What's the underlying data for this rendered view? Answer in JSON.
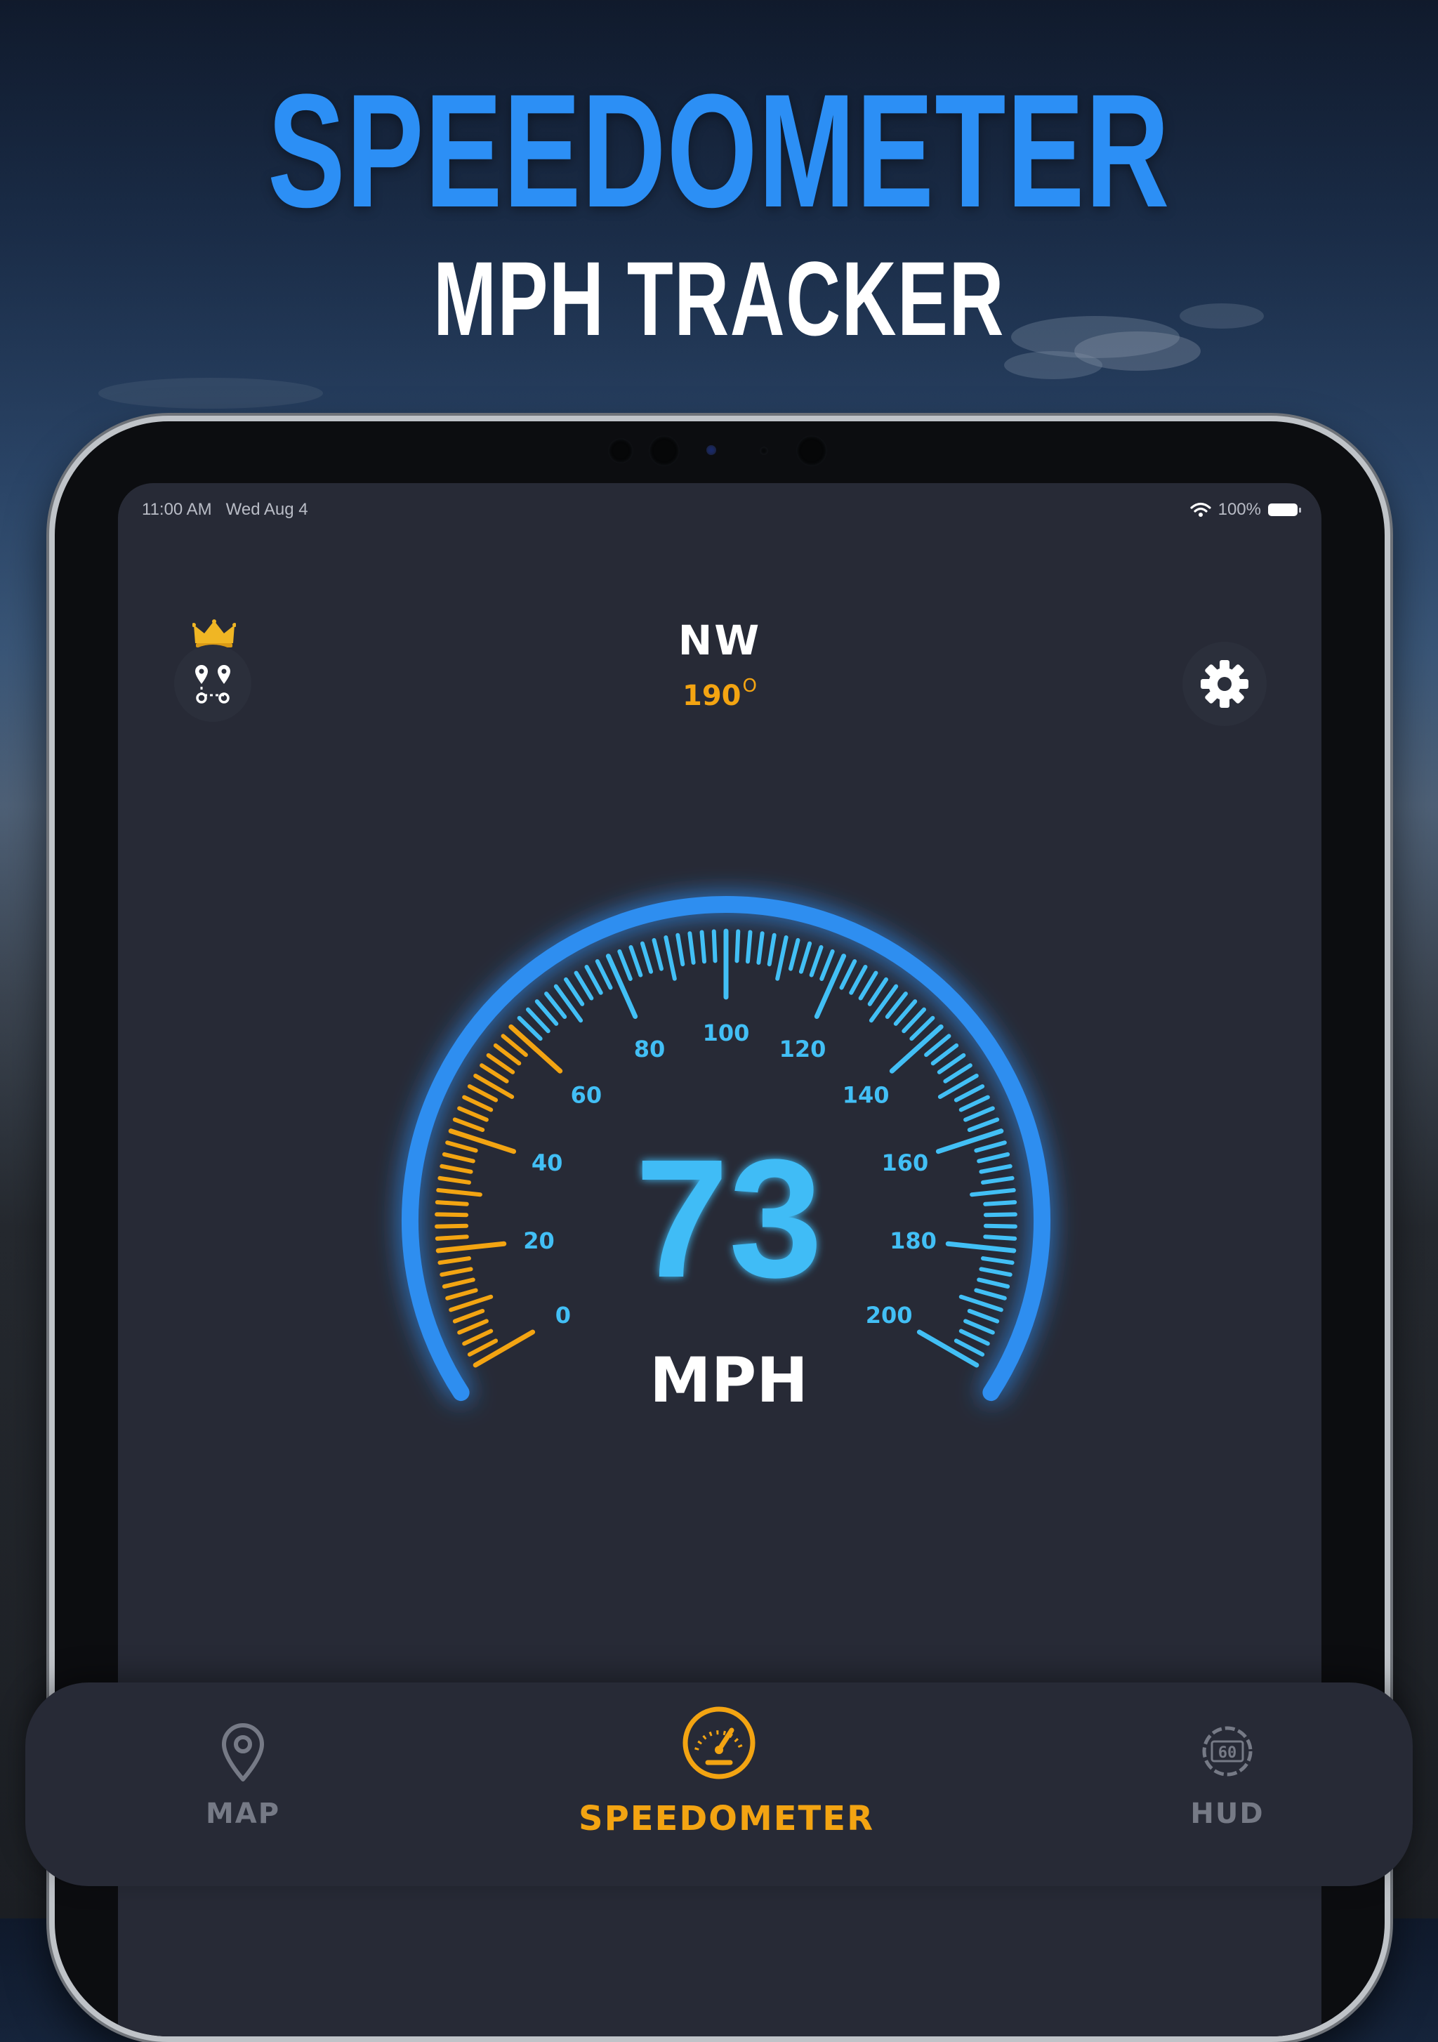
{
  "header": {
    "title": "SPEEDOMETER",
    "subtitle": "MPH TRACKER"
  },
  "status_bar": {
    "time": "11:00 AM",
    "date": "Wed Aug 4",
    "battery": "100%"
  },
  "top_bar": {
    "direction": "NW",
    "degrees": "190",
    "degree_symbol": "O"
  },
  "gauge": {
    "speed": "73",
    "unit": "MPH",
    "min": 0,
    "max": 200,
    "current_value": 73,
    "warning_zone_max": 60,
    "tick_labels": [
      "0",
      "20",
      "40",
      "60",
      "80",
      "100",
      "120",
      "140",
      "160",
      "180",
      "200"
    ],
    "colors": {
      "arc": "#2f8ef0",
      "ticks_normal": "#42bff5",
      "ticks_warning": "#f3a412",
      "speed_text": "#3fbcf6"
    }
  },
  "tabs": [
    {
      "label": "MAP",
      "icon": "map-pin-icon",
      "active": false
    },
    {
      "label": "SPEEDOMETER",
      "icon": "speedometer-icon",
      "active": true
    },
    {
      "label": "HUD",
      "icon": "hud-60-icon",
      "active": false
    }
  ],
  "icons": {
    "premium": "crown-icon",
    "route": "route-pins-icon",
    "settings": "gear-icon",
    "wifi": "wifi-icon"
  },
  "colors": {
    "accent_blue": "#2c8ff5",
    "accent_orange": "#f3a412",
    "screen_bg": "#272a36",
    "inactive_tab": "#767a86"
  }
}
